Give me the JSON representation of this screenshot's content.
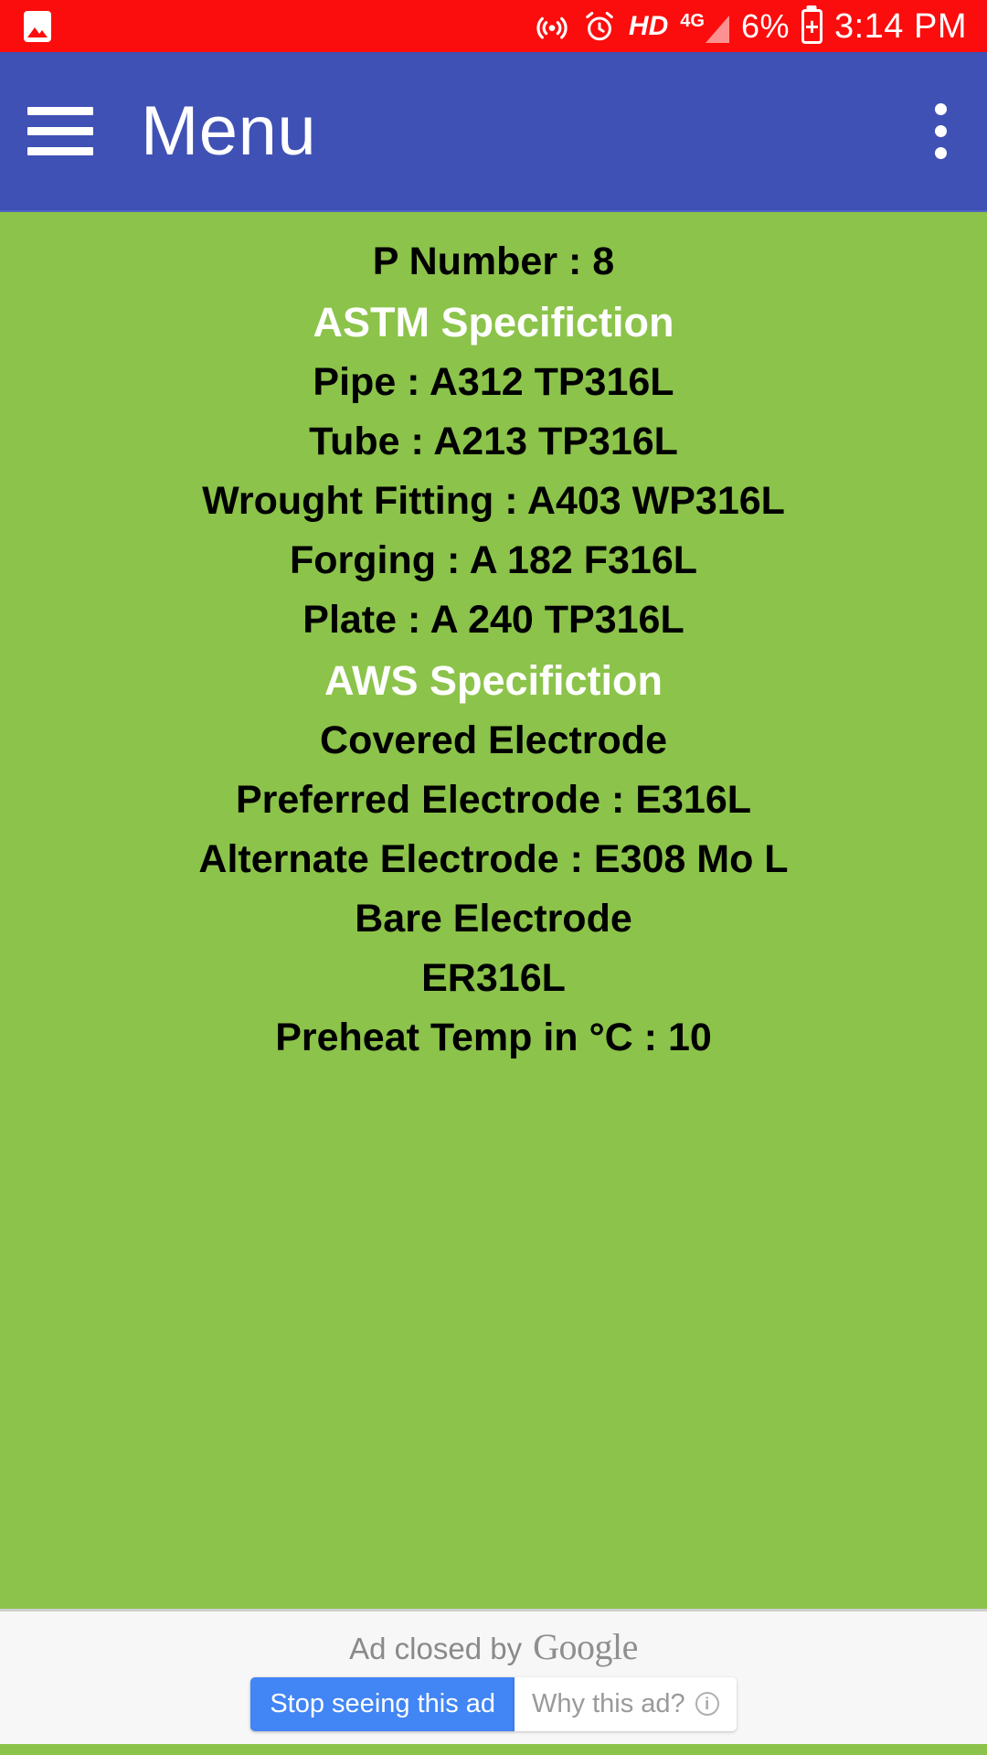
{
  "status_bar": {
    "background": "#FB0D0D",
    "photo_icon": "photo-icon",
    "hotspot_icon": "hotspot-icon",
    "alarm_icon": "alarm-icon",
    "hd_label": "HD",
    "network_label": "4G",
    "battery_percent": "6%",
    "battery_charging_glyph": "+",
    "time": "3:14 PM"
  },
  "app_bar": {
    "background": "#3F51B5",
    "menu_icon": "hamburger-icon",
    "title": "Menu",
    "overflow_icon": "more-vertical-icon"
  },
  "content": {
    "background": "#8CC34A",
    "heading_color": "#FFFFFF",
    "text_color": "#000000",
    "lines": [
      {
        "text": "P Number : 8",
        "style": "value"
      },
      {
        "text": "ASTM Specifiction",
        "style": "heading"
      },
      {
        "text": "Pipe : A312 TP316L",
        "style": "value"
      },
      {
        "text": "Tube : A213 TP316L",
        "style": "value"
      },
      {
        "text": "Wrought Fitting : A403 WP316L",
        "style": "value"
      },
      {
        "text": "Forging : A 182 F316L",
        "style": "value"
      },
      {
        "text": "Plate : A 240 TP316L",
        "style": "value"
      },
      {
        "text": "AWS Specifiction",
        "style": "heading"
      },
      {
        "text": "Covered Electrode",
        "style": "value"
      },
      {
        "text": "Preferred Electrode : E316L",
        "style": "value"
      },
      {
        "text": "Alternate Electrode : E308 Mo L",
        "style": "value"
      },
      {
        "text": "Bare Electrode",
        "style": "value"
      },
      {
        "text": "ER316L",
        "style": "value"
      },
      {
        "text": "Preheat Temp in °C : 10",
        "style": "value"
      }
    ]
  },
  "ad_banner": {
    "background": "#F7F7F7",
    "closed_text": "Ad closed by",
    "brand": "Google",
    "stop_button_label": "Stop seeing this ad",
    "stop_button_color": "#4285F4",
    "why_button_label": "Why this ad?",
    "info_icon": "info-icon",
    "info_glyph": "i"
  }
}
